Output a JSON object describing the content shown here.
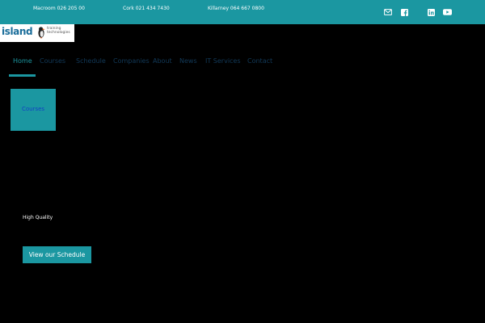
{
  "topbar": {
    "contacts": [
      {
        "label": "Macroom 026 205 00"
      },
      {
        "label": "Cork 021 434 7430"
      },
      {
        "label": "Killarney 064 667 0800"
      }
    ],
    "social_icons": [
      "email-icon",
      "facebook-icon",
      "linkedin-icon",
      "youtube-icon"
    ]
  },
  "logo": {
    "wordmark": "island",
    "tagline_line1": "training",
    "tagline_line2": "technologies"
  },
  "nav": {
    "items": [
      {
        "label": "Home",
        "active": true
      },
      {
        "label": "Courses"
      },
      {
        "label": "Schedule"
      },
      {
        "label": "Companies"
      },
      {
        "label": "About"
      },
      {
        "label": "News"
      },
      {
        "label": "IT Services"
      },
      {
        "label": "Contact"
      }
    ]
  },
  "courses_box": {
    "label": "Courses"
  },
  "hero": {
    "eyebrow": "High Quality",
    "cta_label": "View our Schedule"
  },
  "colors": {
    "brand_teal": "#1b97a1",
    "nav_text": "#123a5a",
    "courses_link": "#1340c4",
    "logo_blue": "#1a6d9a"
  }
}
